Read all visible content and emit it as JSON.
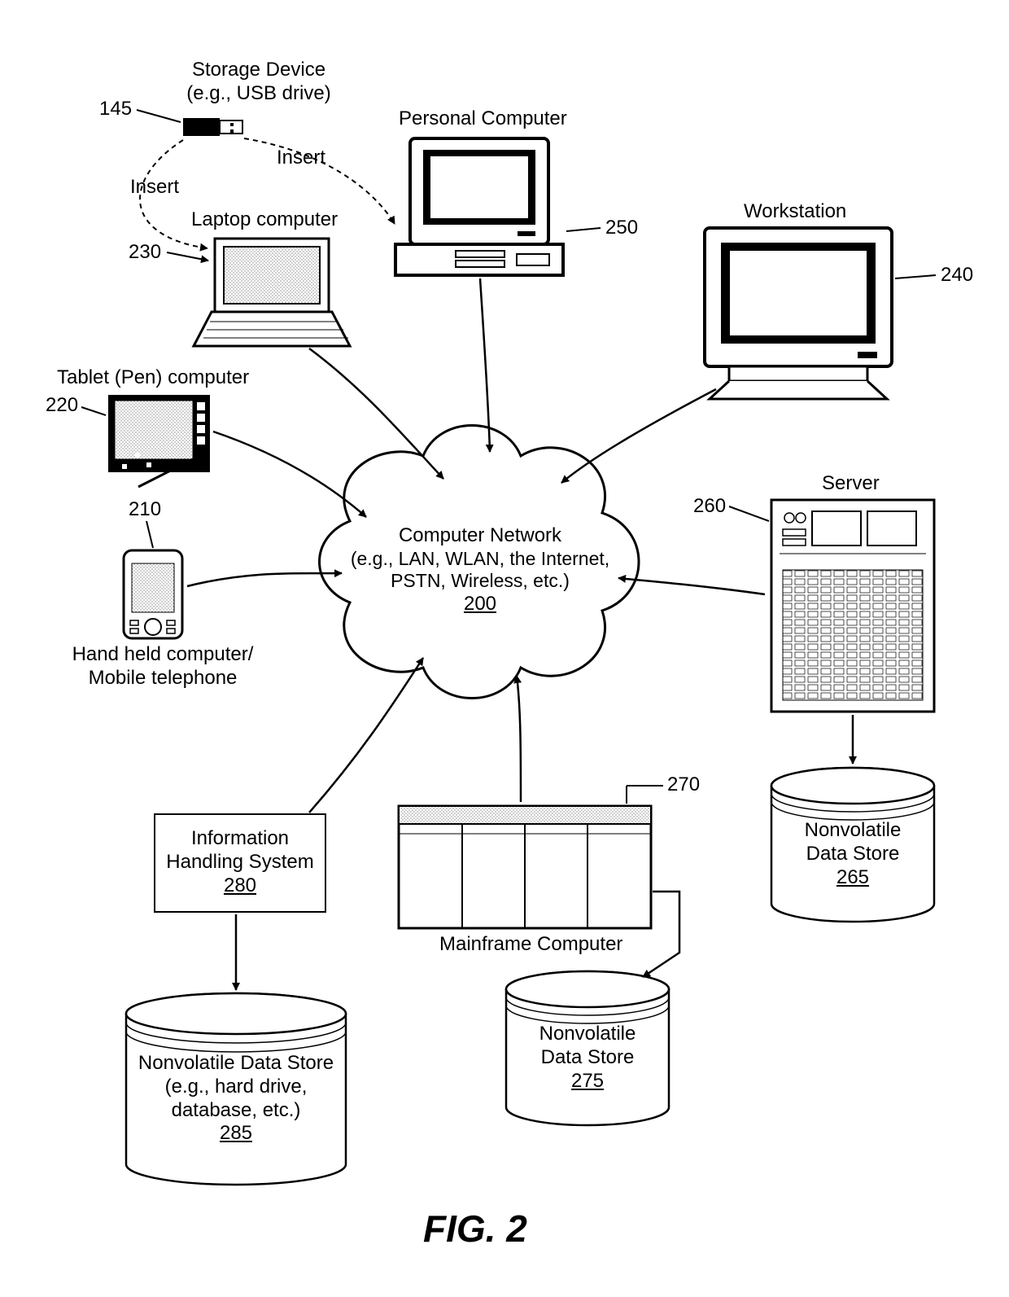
{
  "figure": "FIG. 2",
  "storage": {
    "ref": "145",
    "label": "Storage Device\n(e.g., USB drive)",
    "insert1": "Insert",
    "insert2": "Insert"
  },
  "laptop": {
    "ref": "230",
    "label": "Laptop computer"
  },
  "pc": {
    "ref": "250",
    "label": "Personal Computer"
  },
  "workstation": {
    "ref": "240",
    "label": "Workstation"
  },
  "tablet": {
    "ref": "220",
    "label": "Tablet (Pen) computer"
  },
  "handheld": {
    "ref": "210",
    "label": "Hand held computer/\nMobile telephone"
  },
  "network": {
    "ref": "200",
    "title": "Computer Network",
    "subtitle": "(e.g., LAN, WLAN, the Internet,\nPSTN, Wireless, etc.)"
  },
  "server": {
    "ref": "260",
    "label": "Server"
  },
  "mainframe": {
    "ref": "270",
    "label": "Mainframe Computer"
  },
  "ihs": {
    "ref": "280",
    "label": "Information\nHandling System"
  },
  "store265": {
    "ref": "265",
    "label": "Nonvolatile\nData Store"
  },
  "store275": {
    "ref": "275",
    "label": "Nonvolatile\nData Store"
  },
  "store285": {
    "ref": "285",
    "label": "Nonvolatile Data Store\n(e.g., hard drive,\ndatabase, etc.)"
  }
}
